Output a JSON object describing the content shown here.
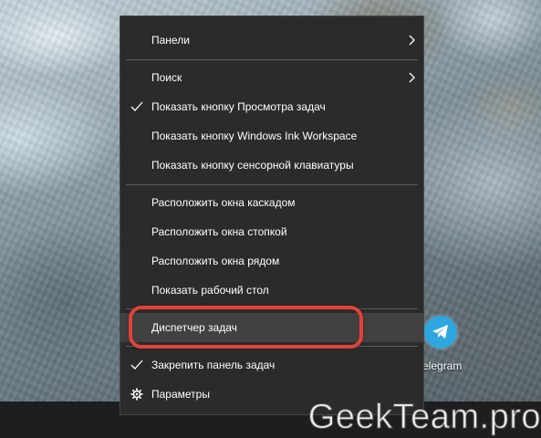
{
  "desktop": {
    "shortcut": {
      "label": "Telegram",
      "icon": "telegram-icon",
      "color": "#2ea6df"
    }
  },
  "context_menu": {
    "hover_color": "#414141",
    "items": [
      {
        "label": "Панели",
        "submenu": true
      },
      {
        "label": "Поиск",
        "submenu": true
      },
      {
        "label": "Показать кнопку Просмотра задач",
        "checked": true
      },
      {
        "label": "Показать кнопку Windows Ink Workspace"
      },
      {
        "label": "Показать кнопку сенсорной клавиатуры"
      },
      {
        "label": "Расположить окна каскадом"
      },
      {
        "label": "Расположить окна стопкой"
      },
      {
        "label": "Расположить окна рядом"
      },
      {
        "label": "Показать рабочий стол"
      },
      {
        "label": "Диспетчер задач",
        "highlighted": true
      },
      {
        "label": "Закрепить панель задач",
        "checked": true
      },
      {
        "label": "Параметры",
        "icon": "gear-icon"
      }
    ]
  },
  "annotation": {
    "highlight_color": "#e3403a"
  },
  "watermark": {
    "text": "GeekTeam.pro"
  }
}
